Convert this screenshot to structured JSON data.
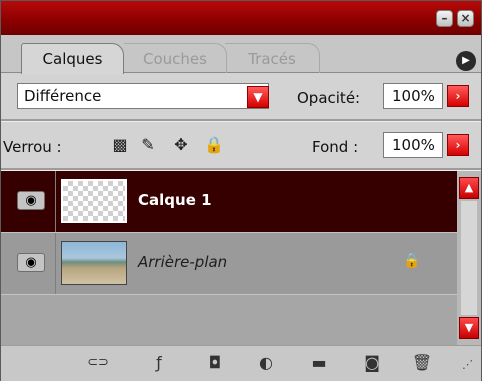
{
  "window": {
    "minimize_icon": "minimize-icon",
    "close_icon": "close-icon",
    "close_glyph": "×",
    "minimize_glyph": "–"
  },
  "tabs": [
    {
      "label": "Calques",
      "active": true
    },
    {
      "label": "Couches",
      "active": false
    },
    {
      "label": "Tracés",
      "active": false
    }
  ],
  "panel_menu_glyph": "▶",
  "blend": {
    "mode": "Différence",
    "arrow_glyph": "▼"
  },
  "opacity": {
    "label": "Opacité:",
    "value": "100%",
    "arrow_glyph": "›"
  },
  "lock": {
    "label": "Verrou :",
    "icons": [
      "lock-transparency-icon",
      "brush-icon",
      "move-icon",
      "lock-icon"
    ],
    "glyphs": [
      "▩",
      "✎",
      "✥",
      "🔒"
    ]
  },
  "fill": {
    "label": "Fond :",
    "value": "100%",
    "arrow_glyph": "›"
  },
  "layers": [
    {
      "name": "Calque 1",
      "selected": true,
      "visible": true,
      "eye_glyph": "◉"
    },
    {
      "name": "Arrière-plan",
      "selected": false,
      "visible": true,
      "locked": true,
      "eye_glyph": "◉",
      "lock_glyph": "🔒"
    }
  ],
  "scrollbar": {
    "up_glyph": "▲",
    "down_glyph": "▼"
  },
  "toolbar": {
    "glyphs": {
      "link": "⊂⊃",
      "fx": "ƒ",
      "mask": "◘",
      "adjust": "◐",
      "group": "▬",
      "new": "◙",
      "trash": "🗑",
      "grip": "⋰"
    }
  },
  "colors": {
    "title_bar": "#8e0000",
    "selected_layer": "#360000",
    "accent_red": "#d60000",
    "panel_bg": "#c6c6c6"
  }
}
